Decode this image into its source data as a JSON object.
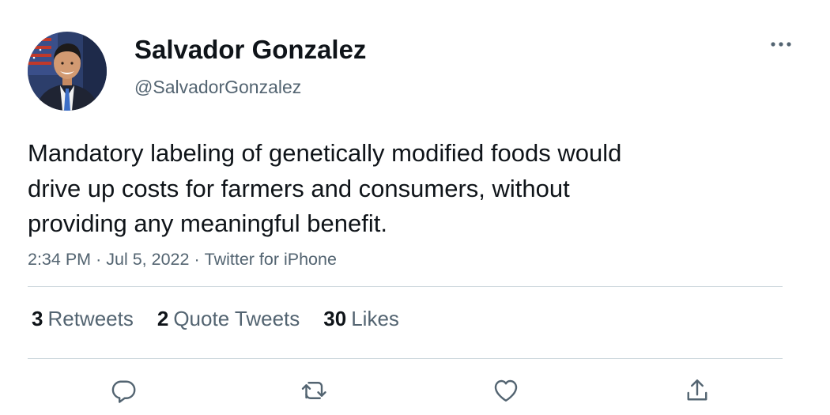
{
  "user": {
    "display_name": "Salvador Gonzalez",
    "handle": "@SalvadorGonzalez"
  },
  "tweet": {
    "text": "Mandatory labeling of genetically modified foods would\ndrive up costs for farmers and consumers, without\nproviding any meaningful benefit.",
    "time": "2:34 PM",
    "date": "Jul 5, 2022",
    "source": "Twitter for iPhone",
    "separator": "·"
  },
  "stats": {
    "retweets_count": "3",
    "retweets_label": "Retweets",
    "quotes_count": "2",
    "quotes_label": "Quote Tweets",
    "likes_count": "30",
    "likes_label": "Likes"
  },
  "icons": {
    "more": "more-horizontal-icon",
    "reply": "reply-icon",
    "retweet": "retweet-icon",
    "like": "heart-icon",
    "share": "share-icon"
  },
  "colors": {
    "text_primary": "#0f1419",
    "text_secondary": "#536471",
    "divider": "#cfd9de"
  }
}
